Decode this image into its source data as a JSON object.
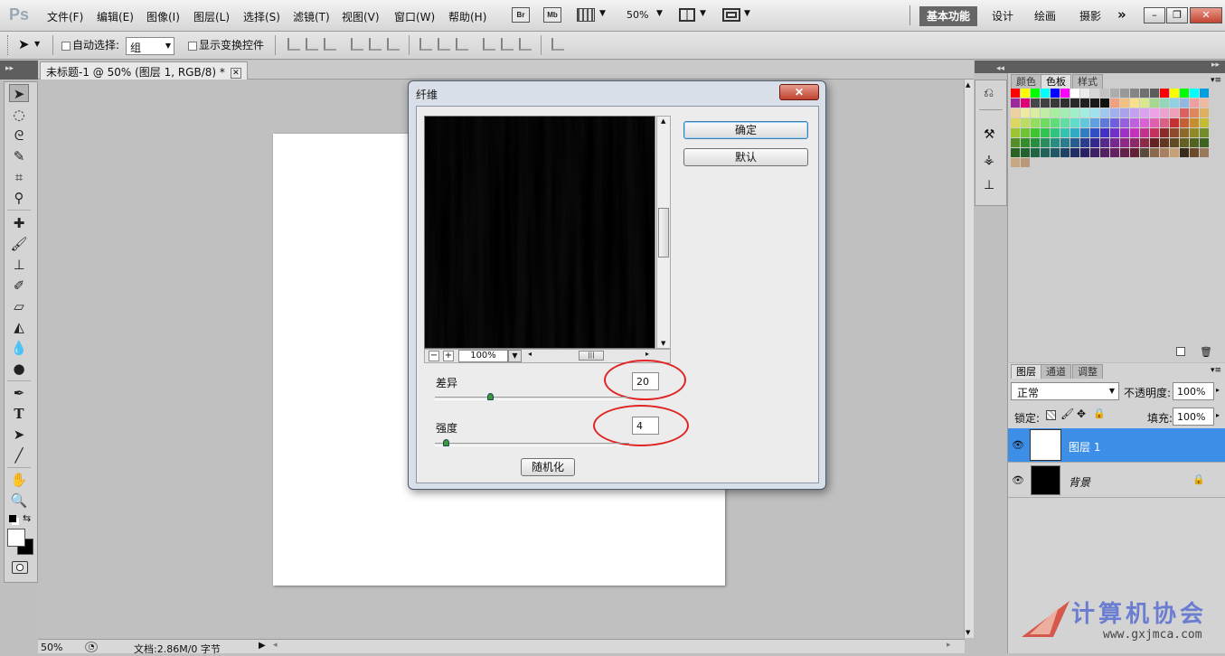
{
  "app": {
    "logo": "Ps"
  },
  "menubar": {
    "items": [
      "文件(F)",
      "编辑(E)",
      "图像(I)",
      "图层(L)",
      "选择(S)",
      "滤镜(T)",
      "视图(V)",
      "窗口(W)",
      "帮助(H)"
    ],
    "br_label": "Br",
    "mb_label": "Mb",
    "zoom": "50%",
    "workspaces": [
      "基本功能",
      "设计",
      "绘画",
      "摄影"
    ]
  },
  "options": {
    "auto_select": "自动选择:",
    "auto_select_value": "组",
    "show_transform": "显示变换控件"
  },
  "document": {
    "tab_title": "未标题-1 @ 50% (图层 1, RGB/8) *"
  },
  "status": {
    "zoom": "50%",
    "doc_info": "文档:2.86M/0 字节"
  },
  "dialog": {
    "title": "纤维",
    "ok": "确定",
    "default": "默认",
    "preview_zoom": "100%",
    "variance_label": "差异",
    "variance_value": "20",
    "strength_label": "强度",
    "strength_value": "4",
    "randomize": "随机化",
    "variance_fraction": 0.29,
    "strength_fraction": 0.06
  },
  "swatch_panel": {
    "tabs": [
      "颜色",
      "色板",
      "样式"
    ]
  },
  "layers_panel": {
    "tabs": [
      "图层",
      "通道",
      "调整"
    ],
    "blend_mode": "正常",
    "opacity_label": "不透明度:",
    "opacity": "100%",
    "lock_label": "锁定:",
    "fill_label": "填充:",
    "fill": "100%",
    "layers": [
      {
        "name": "图层 1"
      },
      {
        "name": "背景"
      }
    ]
  },
  "watermark": {
    "text": "计算机协会",
    "url": "www.gxjmca.com"
  }
}
